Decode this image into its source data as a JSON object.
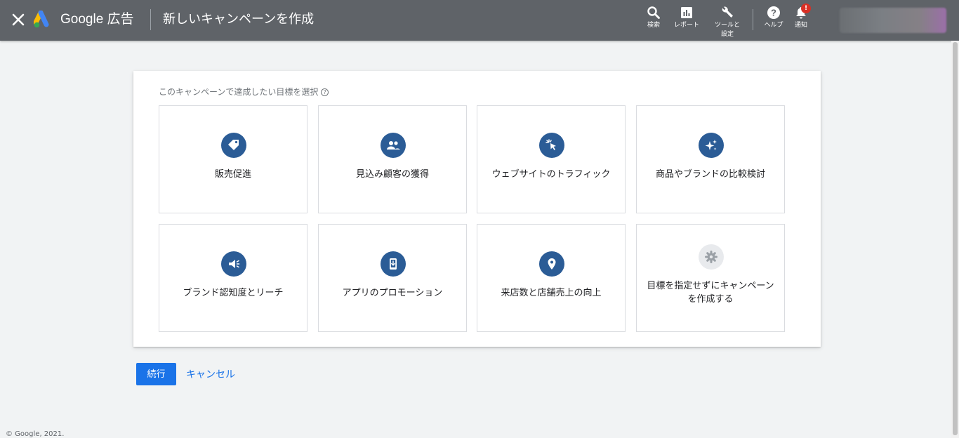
{
  "header": {
    "brand": "Google 広告",
    "title": "新しいキャンペーンを作成",
    "tools": {
      "search": "検索",
      "reports": "レポート",
      "tools_settings": "ツールと\n設定",
      "help": "ヘルプ",
      "notifications": "通知"
    },
    "notification_badge": "!"
  },
  "card": {
    "label": "このキャンペーンで達成したい目標を選択",
    "help_glyph": "?",
    "goals": [
      {
        "label": "販売促進",
        "icon": "tag-icon"
      },
      {
        "label": "見込み顧客の獲得",
        "icon": "people-icon"
      },
      {
        "label": "ウェブサイトのトラフィック",
        "icon": "cursor-click-icon"
      },
      {
        "label": "商品やブランドの比較検討",
        "icon": "sparkle-icon"
      },
      {
        "label": "ブランド認知度とリーチ",
        "icon": "megaphone-icon"
      },
      {
        "label": "アプリのプロモーション",
        "icon": "phone-download-icon"
      },
      {
        "label": "来店数と店舗売上の向上",
        "icon": "location-pin-icon"
      },
      {
        "label": "目標を指定せずにキャンペーンを作成する",
        "icon": "gear-icon"
      }
    ]
  },
  "actions": {
    "continue": "続行",
    "cancel": "キャンセル"
  },
  "footer": "© Google, 2021.",
  "colors": {
    "header_bg": "#5f6368",
    "icon_circle": "#2b5c96",
    "primary": "#1a73e8",
    "badge": "#d93025"
  }
}
